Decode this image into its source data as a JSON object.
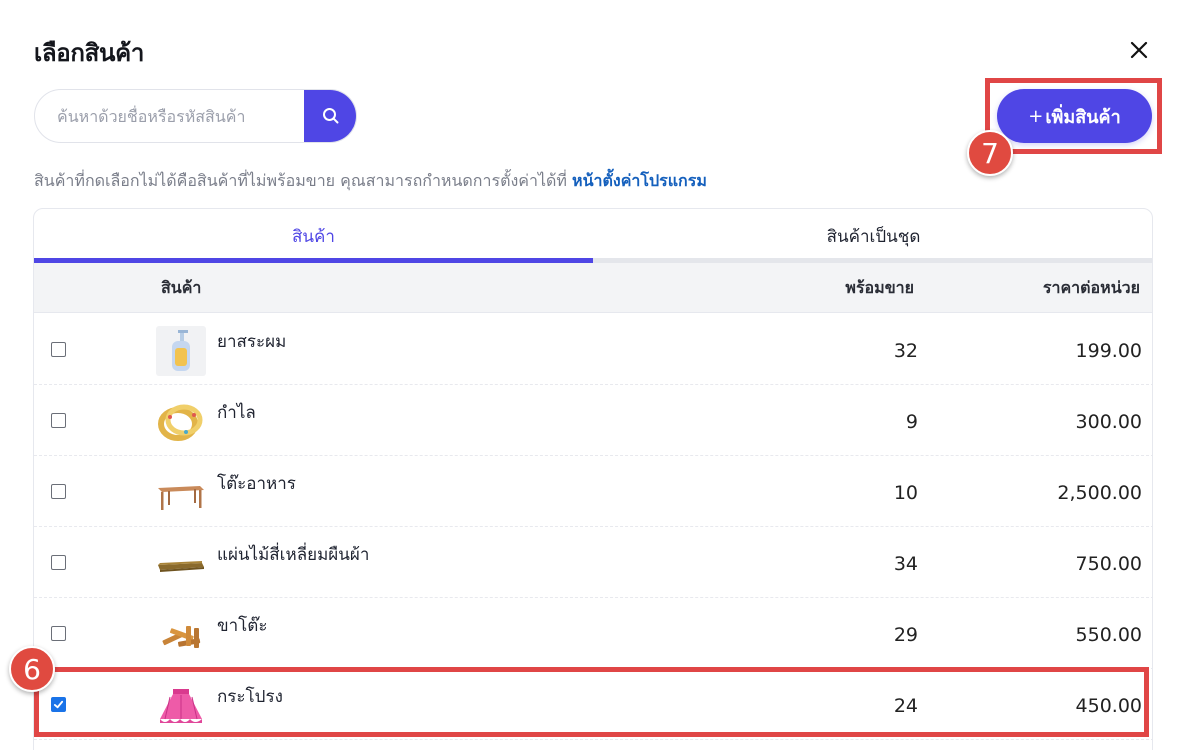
{
  "modal": {
    "title": "เลือกสินค้า",
    "close_icon": "close-icon"
  },
  "search": {
    "placeholder": "ค้นหาด้วยชื่อหรือรหัสสินค้า",
    "value": "",
    "icon": "search-icon"
  },
  "add_button": {
    "plus": "+",
    "label": "เพิ่มสินค้า"
  },
  "info": {
    "text": "สินค้าที่กดเลือกไม่ได้คือสินค้าที่ไม่พร้อมขาย คุณสามารถกำหนดการตั้งค่าได้ที่ ",
    "link": "หน้าตั้งค่าโปรแกรม"
  },
  "tabs": [
    {
      "label": "สินค้า",
      "active": true
    },
    {
      "label": "สินค้าเป็นชุด",
      "active": false
    }
  ],
  "table": {
    "headers": {
      "product": "สินค้า",
      "stock": "พร้อมขาย",
      "price": "ราคาต่อหน่วย"
    },
    "rows": [
      {
        "name": "ยาสระผม",
        "stock": "32",
        "price": "199.00",
        "checked": false,
        "thumb": "shampoo-bottle"
      },
      {
        "name": "กำไล",
        "stock": "9",
        "price": "300.00",
        "checked": false,
        "thumb": "bracelet"
      },
      {
        "name": "โต๊ะอาหาร",
        "stock": "10",
        "price": "2,500.00",
        "checked": false,
        "thumb": "dining-table"
      },
      {
        "name": "แผ่นไม้สี่เหลี่ยมผืนผ้า",
        "stock": "34",
        "price": "750.00",
        "checked": false,
        "thumb": "wood-plank"
      },
      {
        "name": "ขาโต๊ะ",
        "stock": "29",
        "price": "550.00",
        "checked": false,
        "thumb": "table-legs"
      },
      {
        "name": "กระโปรง",
        "stock": "24",
        "price": "450.00",
        "checked": true,
        "thumb": "pink-skirt"
      }
    ]
  },
  "annotations": {
    "step_add": "7",
    "step_select": "6",
    "highlight_color": "#e04646"
  },
  "colors": {
    "accent": "#4f46e5",
    "link": "#1560bd",
    "checkbox_checked": "#1a73e8"
  }
}
